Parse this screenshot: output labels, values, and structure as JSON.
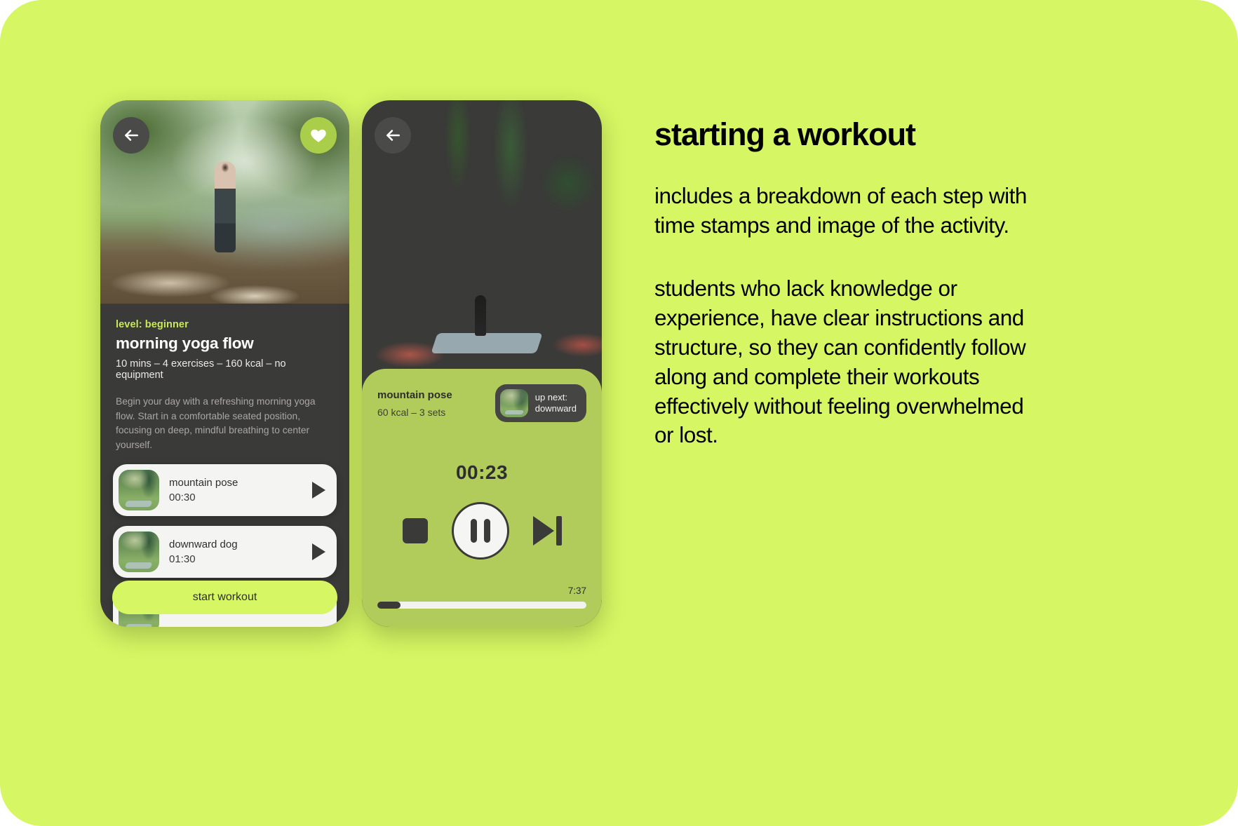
{
  "theme": {
    "background_lime": "#d6f663",
    "phone_dark": "#3a3a38",
    "player_green": "#b2cc5c",
    "accent_level": "#c9e85f",
    "card_light": "#f4f4f2"
  },
  "phone_detail": {
    "back_icon": "arrow-left-icon",
    "favorite_icon": "heart-icon",
    "level": "level: beginner",
    "title": "morning yoga flow",
    "meta": "10 mins – 4 exercises – 160 kcal – no equipment",
    "description": "Begin your day with a refreshing morning yoga flow. Start in a comfortable seated position, focusing on deep, mindful breathing to center yourself.",
    "exercises": [
      {
        "name": "mountain pose",
        "time": "00:30",
        "play_icon": "play-icon"
      },
      {
        "name": "downward dog",
        "time": "01:30",
        "play_icon": "play-icon"
      }
    ],
    "start_button": "start workout"
  },
  "phone_player": {
    "back_icon": "arrow-left-icon",
    "current_name": "mountain pose",
    "current_meta": "60 kcal – 3 sets",
    "up_next_label": "up next:\ndownward",
    "timer": "00:23",
    "stop_icon": "stop-icon",
    "pause_icon": "pause-icon",
    "skip_icon": "skip-next-icon",
    "elapsed_or_total": "7:37",
    "progress_percent": 11
  },
  "copy": {
    "heading": "starting a workout",
    "paragraph_1": "includes a breakdown of each step with time stamps and image of the activity.",
    "paragraph_2": "students who lack knowledge or experience, have clear instructions and structure, so they can confidently follow along and complete their workouts effectively without feeling overwhelmed or lost."
  }
}
